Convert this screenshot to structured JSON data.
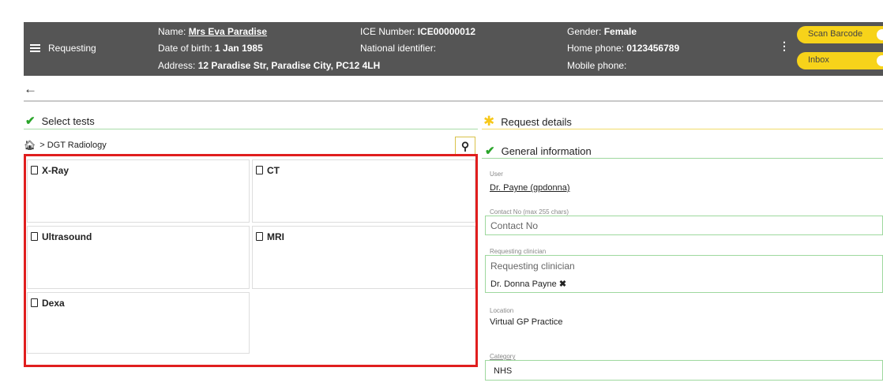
{
  "header": {
    "menu_label": "Requesting",
    "name_label": "Name:",
    "name_value": "Mrs Eva Paradise",
    "dob_label": "Date of birth:",
    "dob_value": "1 Jan 1985",
    "address_label": "Address:",
    "address_value": "12 Paradise Str, Paradise City, PC12 4LH",
    "ice_label": "ICE Number:",
    "ice_value": "ICE00000012",
    "national_label": "National identifier:",
    "national_value": "",
    "gender_label": "Gender:",
    "gender_value": "Female",
    "home_phone_label": "Home phone:",
    "home_phone_value": "0123456789",
    "mobile_label": "Mobile phone:",
    "mobile_value": "",
    "scan_barcode_label": "Scan Barcode",
    "inbox_label": "Inbox"
  },
  "select_tests": {
    "title": "Select tests",
    "breadcrumb": "> DGT Radiology",
    "tests": [
      {
        "label": "X-Ray"
      },
      {
        "label": "CT"
      },
      {
        "label": "Ultrasound"
      },
      {
        "label": "MRI"
      },
      {
        "label": "Dexa"
      }
    ]
  },
  "request_details": {
    "title": "Request details",
    "general_title": "General information",
    "user_label": "User",
    "user_value": "Dr. Payne (gpdonna)",
    "contact_label": "Contact No (max 255 chars)",
    "contact_placeholder": "Contact No",
    "clinician_label": "Requesting clinician",
    "clinician_placeholder": "Requesting clinician",
    "clinician_value": "Dr. Donna Payne",
    "location_label": "Location",
    "location_value": "Virtual GP Practice",
    "category_label": "Category",
    "category_value": "NHS"
  },
  "colors": {
    "header_bg": "#555555",
    "accent_yellow": "#f7d31a",
    "success_green": "#2aa52a",
    "highlight_red": "#e01e1e"
  }
}
